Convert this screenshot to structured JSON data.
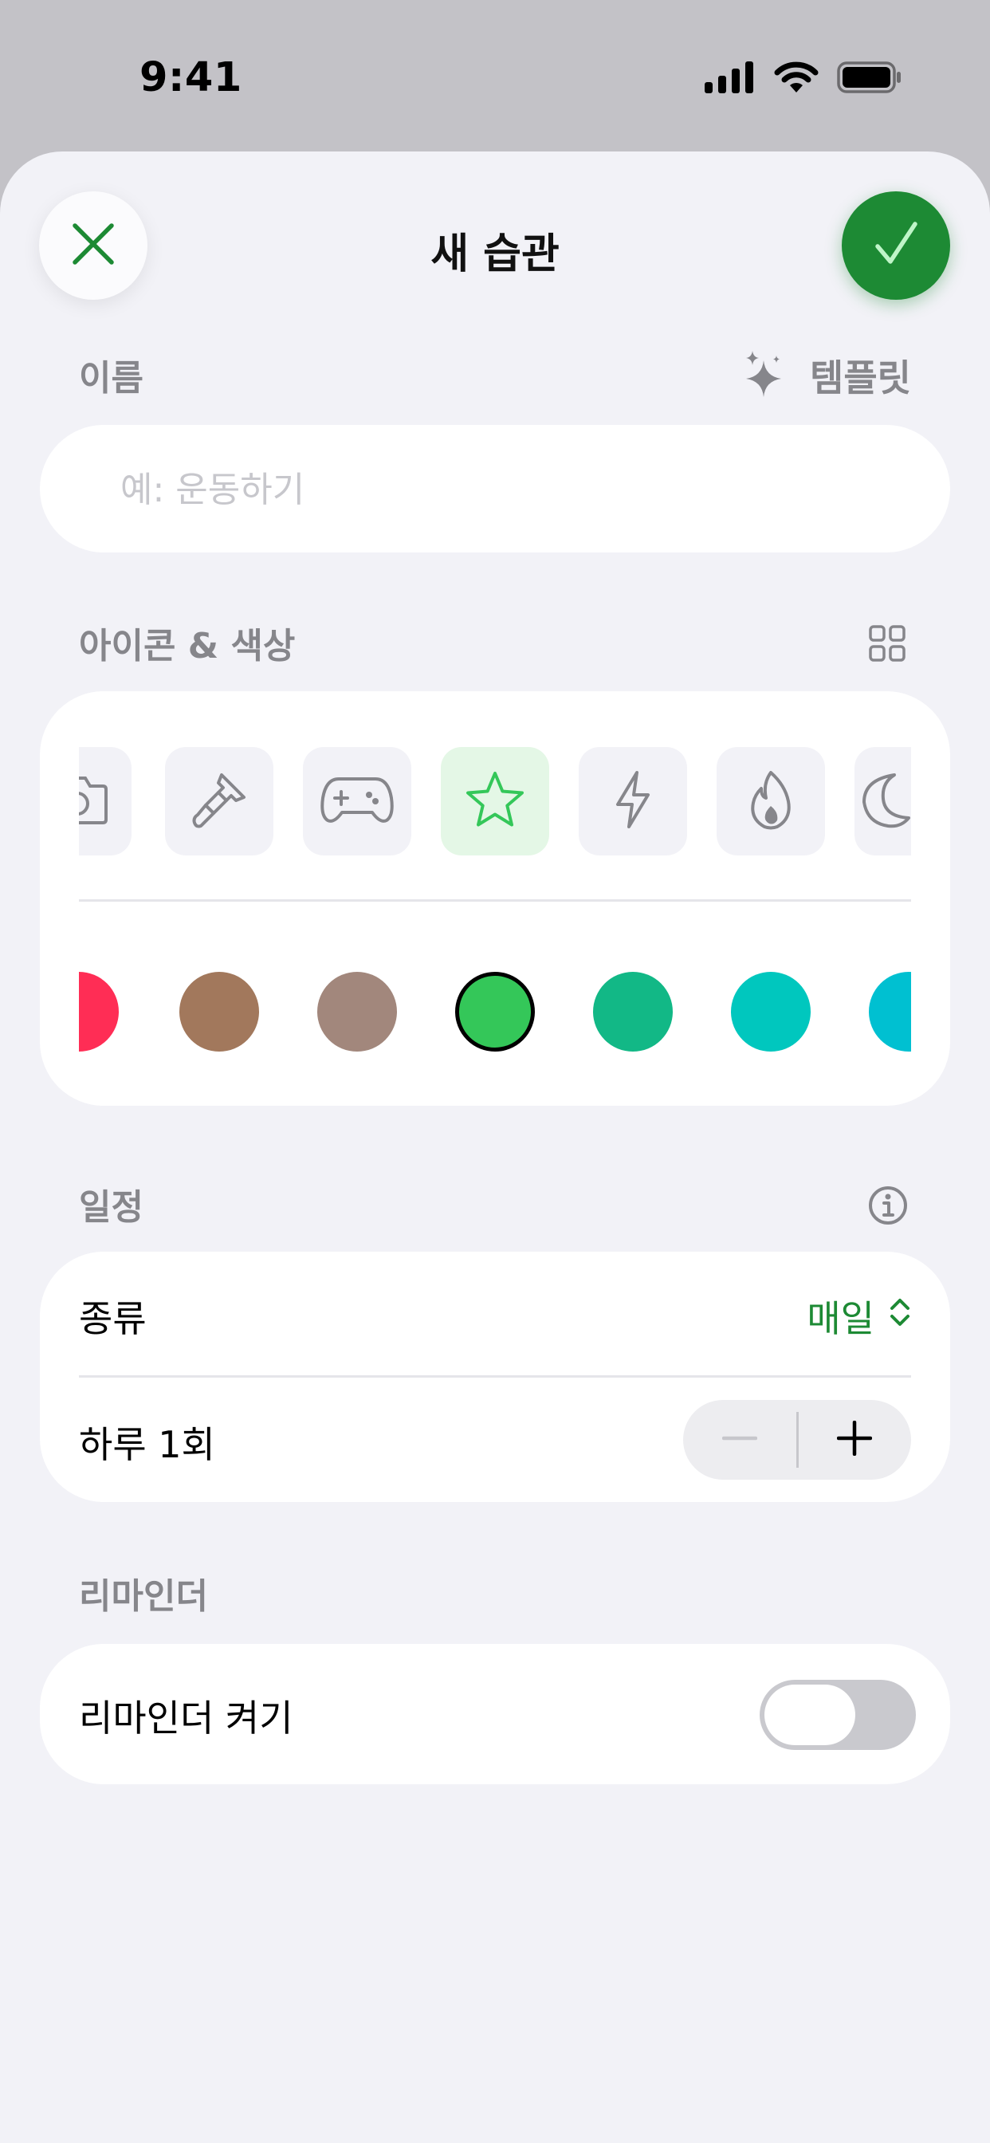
{
  "status_bar": {
    "time": "9:41",
    "icons": [
      "cellular-signal-icon",
      "wifi-icon",
      "battery-icon"
    ]
  },
  "sheet": {
    "title": "새 습관",
    "close_icon": "close-x-icon",
    "confirm_icon": "checkmark-icon"
  },
  "name_section": {
    "label": "이름",
    "template_label": "템플릿",
    "template_icon": "sparkles-icon",
    "input_value": "",
    "input_placeholder": "예: 운동하기"
  },
  "icon_color_section": {
    "label": "아이콘 & 색상",
    "grid_icon": "grid-icon",
    "icons": [
      "camera-icon",
      "paintbrush-icon",
      "gamecontroller-icon",
      "star-icon",
      "bolt-icon",
      "flame-icon",
      "moon-icon"
    ],
    "selected_icon": "star-icon",
    "colors": [
      "#ff2d55",
      "#a2785c",
      "#a2877c",
      "#34c759",
      "#12b886",
      "#00c7be",
      "#00c0d1"
    ],
    "selected_color": "#34c759"
  },
  "schedule_section": {
    "label": "일정",
    "info_icon": "info-circle-icon",
    "type_label": "종류",
    "type_value": "매일",
    "count_label": "하루 1회",
    "count": 1
  },
  "reminder_section": {
    "label": "리마인더",
    "toggle_label": "리마인더 켜기",
    "enabled": false
  },
  "colors": {
    "accent": "#1d8a34",
    "accent_light": "#34c759",
    "background": "#f2f2f7",
    "secondary_text": "#86868b"
  }
}
